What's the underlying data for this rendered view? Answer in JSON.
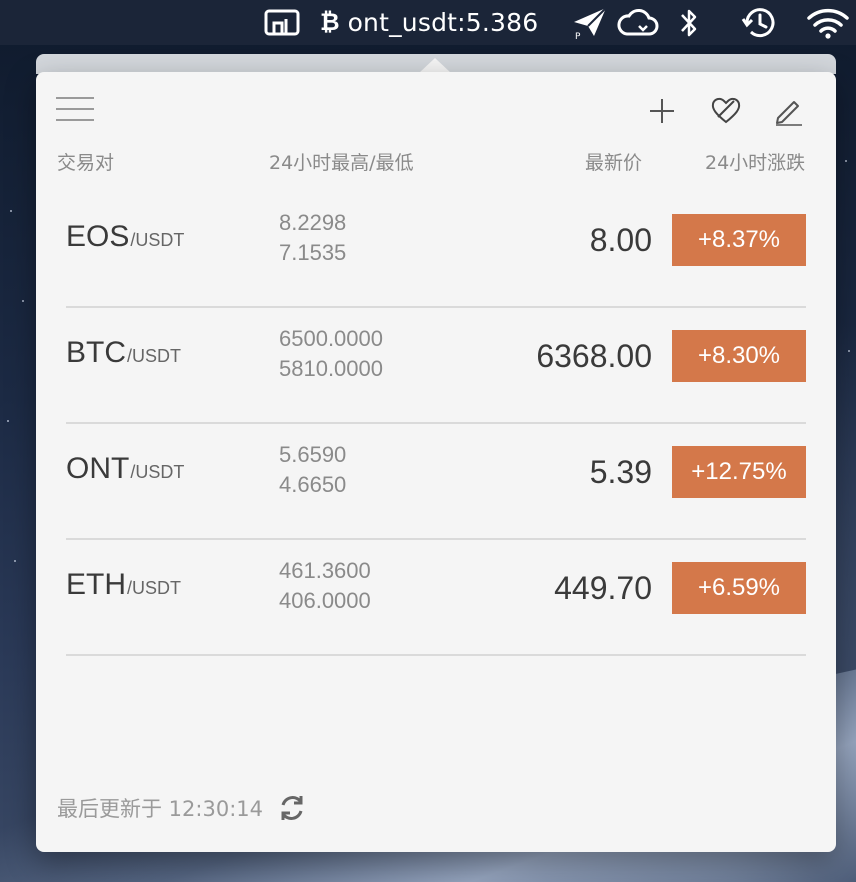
{
  "menubar": {
    "ticker_glyph": "₿",
    "ticker_text": "ont_usdt:5.386",
    "icons": [
      "screen-mirroring-icon",
      "bitcoin-icon",
      "paper-plane-icon",
      "cloud-icon",
      "bluetooth-icon",
      "time-machine-icon",
      "wifi-icon"
    ]
  },
  "toolbar": {
    "icons": [
      "hamburger-menu-icon",
      "plus-icon",
      "heart-icon",
      "pencil-icon"
    ]
  },
  "table": {
    "headers": {
      "pair": "交易对",
      "range": "24小时最高/最低",
      "price": "最新价",
      "change": "24小时涨跌"
    },
    "rows": [
      {
        "base": "EOS",
        "quote": "/USDT",
        "high": "8.2298",
        "low": "7.1535",
        "price": "8.00",
        "change": "+8.37%"
      },
      {
        "base": "BTC",
        "quote": "/USDT",
        "high": "6500.0000",
        "low": "5810.0000",
        "price": "6368.00",
        "change": "+8.30%"
      },
      {
        "base": "ONT",
        "quote": "/USDT",
        "high": "5.6590",
        "low": "4.6650",
        "price": "5.39",
        "change": "+12.75%"
      },
      {
        "base": "ETH",
        "quote": "/USDT",
        "high": "461.3600",
        "low": "406.0000",
        "price": "449.70",
        "change": "+6.59%"
      }
    ]
  },
  "footer": {
    "updated_text": "最后更新于 12:30:14"
  },
  "colors": {
    "change_badge": "#d4784a",
    "popover_bg": "#f5f5f5",
    "menubar_bg": "#1c263a"
  }
}
